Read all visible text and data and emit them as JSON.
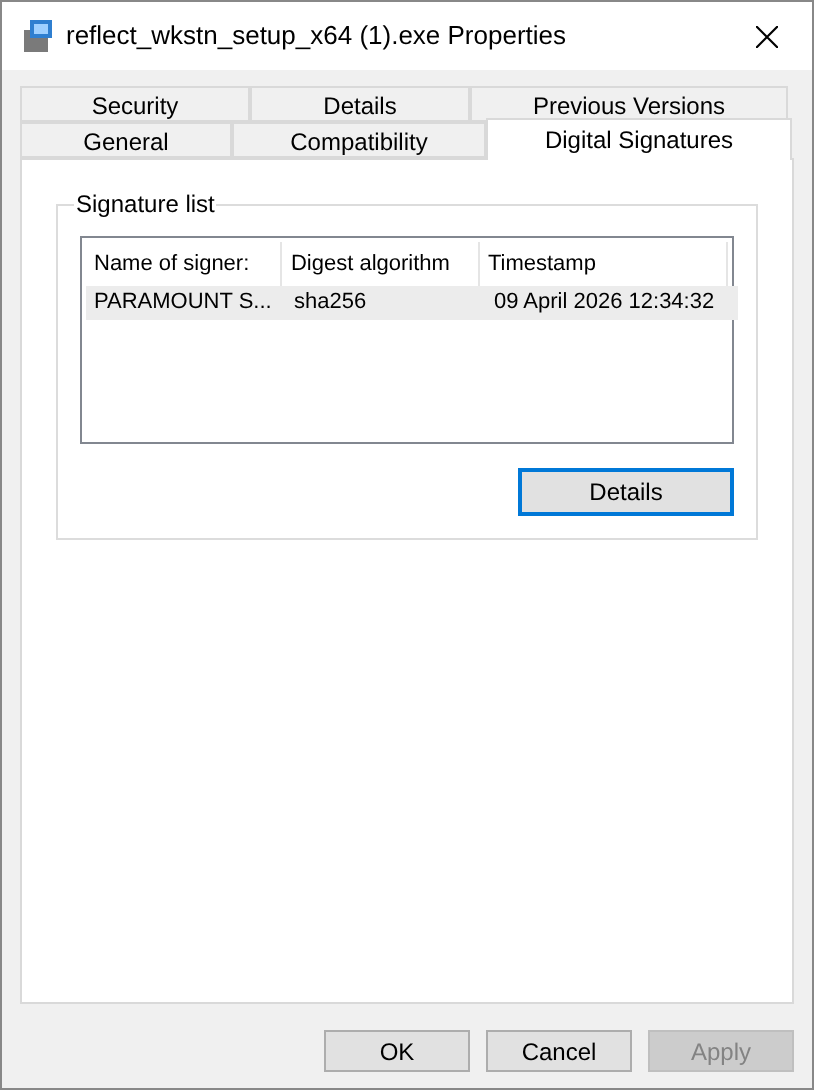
{
  "window": {
    "title": "reflect_wkstn_setup_x64 (1).exe Properties"
  },
  "tab_rows": [
    [
      {
        "label": "Security",
        "selected": false
      },
      {
        "label": "Details",
        "selected": false
      },
      {
        "label": "Previous Versions",
        "selected": false
      }
    ],
    [
      {
        "label": "General",
        "selected": false
      },
      {
        "label": "Compatibility",
        "selected": false
      },
      {
        "label": "Digital Signatures",
        "selected": true
      }
    ]
  ],
  "signature_list": {
    "title": "Signature list",
    "columns": [
      "Name of signer:",
      "Digest algorithm",
      "Timestamp"
    ],
    "rows": [
      {
        "cells": [
          "PARAMOUNT S...",
          "sha256",
          "09 April 2026 12:34:32"
        ],
        "selected": true
      }
    ],
    "details_button": {
      "label": "Details",
      "focused": true
    }
  },
  "buttons": [
    {
      "label": "OK",
      "disabled": false
    },
    {
      "label": "Cancel",
      "disabled": false
    },
    {
      "label": "Apply",
      "disabled": true
    }
  ]
}
